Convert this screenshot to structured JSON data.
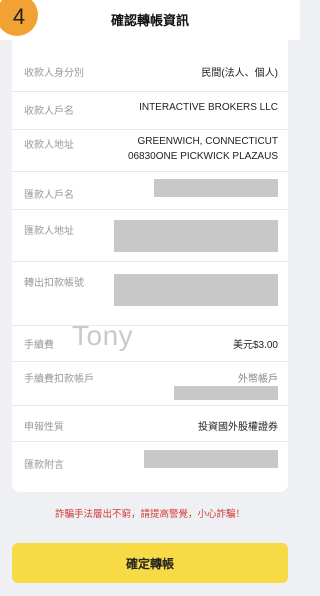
{
  "header": {
    "step": "4",
    "title": "確認轉帳資訊"
  },
  "details": {
    "identity_label": "收款人身分別",
    "identity_value": "民間(法人、個人)",
    "payee_name_label": "收款人戶名",
    "payee_name_value": "INTERACTIVE BROKERS LLC",
    "payee_address_label": "收款人地址",
    "payee_address_line1": "GREENWICH, CONNECTICUT",
    "payee_address_line2": "06830ONE PICKWICK PLAZAUS",
    "remitter_name_label": "匯款人戶名",
    "remitter_address_label": "匯款人地址",
    "debit_account_label": "轉出扣款帳號",
    "fee_label": "手續費",
    "fee_value": "美元$3.00",
    "fee_account_label": "手續費扣款帳戶",
    "fee_account_value": "外幣帳戶",
    "declaration_label": "申報性質",
    "declaration_value": "投資國外股權證券",
    "remark_label": "匯款附言"
  },
  "watermark": "Tony",
  "warning": "詐騙手法層出不窮，請提高警覺，小心詐騙！",
  "confirm_button": "確定轉帳",
  "colors": {
    "badge": "#f2a233",
    "button": "#f8da46",
    "warning": "#d23b3b",
    "redaction": "#c8c8c8"
  }
}
